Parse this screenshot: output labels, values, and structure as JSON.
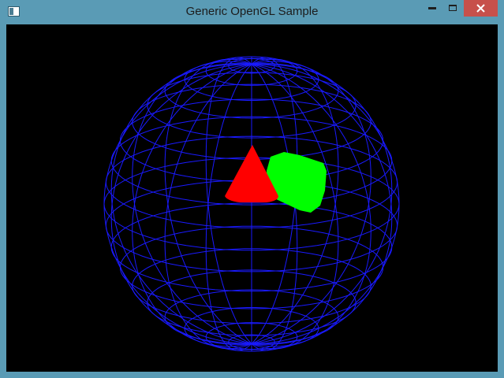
{
  "window": {
    "title": "Generic OpenGL Sample",
    "app_icon": "window-icon",
    "controls": [
      "minimize-icon",
      "maximize-icon",
      "close-icon"
    ],
    "title_bar_color": "#5a9bb5",
    "close_button_color": "#c7504b"
  },
  "scene": {
    "background": "#000000",
    "sphere": {
      "style": "wireframe",
      "color": "#1a1aff"
    },
    "cone": {
      "color": "#ff0000"
    },
    "cylinder": {
      "color": "#00ff00"
    }
  }
}
